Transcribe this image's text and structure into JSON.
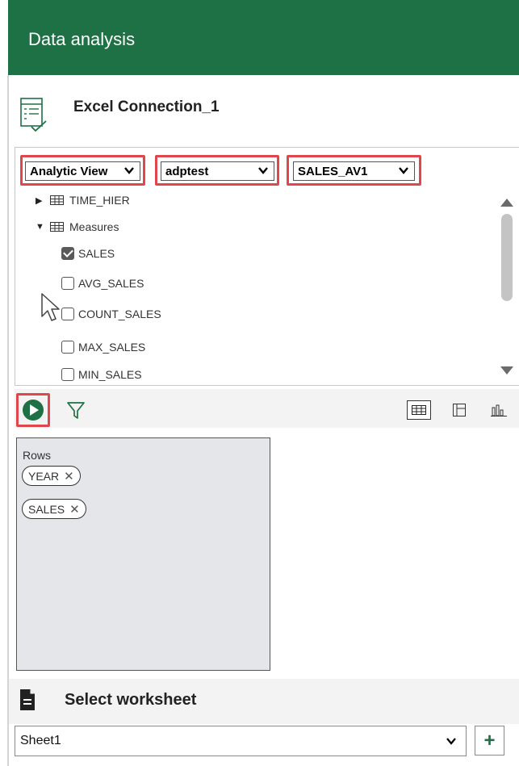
{
  "header": {
    "title": "Data analysis"
  },
  "connection": {
    "name": "Excel Connection_1",
    "icon": "connection-checklist-icon"
  },
  "dropdowns": {
    "view_type": "Analytic View",
    "schema": "adptest",
    "object": "SALES_AV1"
  },
  "tree": {
    "time_hier": "TIME_HIER",
    "measures": "Measures",
    "items": [
      {
        "label": "SALES",
        "checked": true
      },
      {
        "label": "AVG_SALES",
        "checked": false
      },
      {
        "label": "COUNT_SALES",
        "checked": false
      },
      {
        "label": "MAX_SALES",
        "checked": false
      },
      {
        "label": "MIN_SALES",
        "checked": false
      }
    ]
  },
  "toolbar": {
    "run_icon": "run-play-icon",
    "filter_icon": "filter-icon",
    "views": [
      "table-view-icon",
      "pivot-view-icon",
      "chart-view-icon"
    ]
  },
  "rows": {
    "label": "Rows",
    "chips": [
      "YEAR",
      "SALES"
    ]
  },
  "worksheet": {
    "title": "Select worksheet",
    "selected": "Sheet1",
    "add_label": "+"
  },
  "colors": {
    "brand": "#1e7145",
    "highlight": "#e0474c"
  }
}
